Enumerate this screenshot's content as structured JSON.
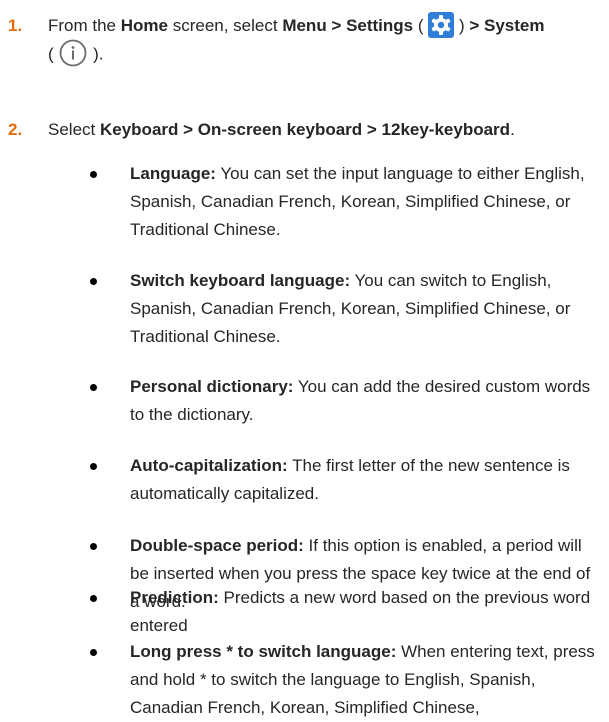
{
  "steps": [
    {
      "number": "1.",
      "t1": "From the ",
      "b1": "Home",
      "t2": " screen, select ",
      "b2": "Menu > Settings",
      "t3": " ( ",
      "t4": " ) ",
      "b3": "> System",
      "t5": "( ",
      "t6": " ).",
      "icons": [
        "gear-icon",
        "info-icon"
      ]
    },
    {
      "number": "2.",
      "t1": "Select ",
      "b1": "Keyboard > On-screen keyboard > 12key-keyboard",
      "t2": "."
    }
  ],
  "bullets": [
    {
      "label": "Language:",
      "text": " You can set the input language to either English, Spanish, Canadian French, Korean, Simplified Chinese, or Traditional Chinese."
    },
    {
      "label": "Switch keyboard language:",
      "text": " You can switch to English, Spanish, Canadian French, Korean, Simplified Chinese, or Traditional Chinese."
    },
    {
      "label": "Personal dictionary:",
      "text": " You can add the desired custom words to the dictionary."
    },
    {
      "label": "Auto-capitalization:",
      "text": " The first letter of the new sentence is automatically capitalized."
    },
    {
      "label": "Double-space period:",
      "text": " If this option is enabled, a period will be inserted when you press the space key twice at the end of a word."
    },
    {
      "label": "Prediction:",
      "text": " Predicts a new word based on the previous word entered"
    },
    {
      "label": "Long press * to switch language:",
      "text": " When entering text, press and hold * to switch the language to English, Spanish, Canadian French, Korean, Simplified Chinese,"
    }
  ],
  "colors": {
    "step_number": "#e36c0a",
    "gear_icon_bg": "#2f7ed8",
    "text": "#262626"
  }
}
